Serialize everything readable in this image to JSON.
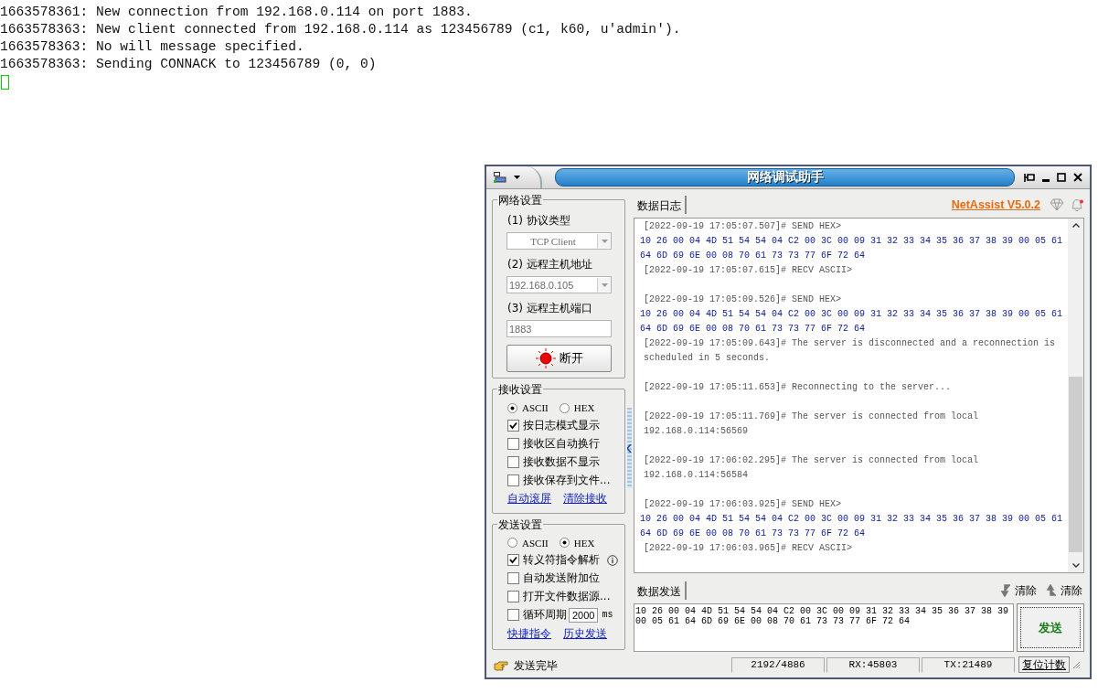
{
  "terminal": {
    "lines": [
      "1663578361: New connection from 192.168.0.114 on port 1883.",
      "1663578363: New client connected from 192.168.0.114 as 123456789 (c1, k60, u'admin').",
      "1663578363: No will message specified.",
      "1663578363: Sending CONNACK to 123456789 (0, 0)"
    ],
    "cursor_visible": true
  },
  "window": {
    "title": "网络调试助手",
    "product_link": "NetAssist V5.0.2"
  },
  "network_settings": {
    "title": "网络设置",
    "fields": [
      {
        "label": "(1) 协议类型",
        "kind": "select",
        "value": "TCP Client",
        "disabled": true
      },
      {
        "label": "(2) 远程主机地址",
        "kind": "select",
        "value": "192.168.0.105",
        "disabled": true
      },
      {
        "label": "(3) 远程主机端口",
        "kind": "input",
        "value": "1883",
        "disabled": true
      }
    ],
    "connect_button": {
      "label": "断开",
      "led_on": true
    }
  },
  "receive_settings": {
    "title": "接收设置",
    "radios": [
      {
        "label": "ASCII",
        "selected": true
      },
      {
        "label": "HEX",
        "selected": false
      }
    ],
    "options": [
      {
        "kind": "plain",
        "label": "按日志模式显示",
        "checked": true
      },
      {
        "kind": "plain",
        "label": "接收区自动换行",
        "checked": false
      },
      {
        "kind": "plain",
        "label": "接收数据不显示",
        "checked": false
      },
      {
        "kind": "plain",
        "label": "接收保存到文件...",
        "checked": false
      }
    ],
    "links": [
      "自动滚屏",
      "清除接收"
    ]
  },
  "send_settings": {
    "title": "发送设置",
    "radios": [
      {
        "label": "ASCII",
        "selected": false
      },
      {
        "label": "HEX",
        "selected": true
      }
    ],
    "options": [
      {
        "kind": "info",
        "label": "转义符指令解析",
        "checked": true
      },
      {
        "kind": "plain",
        "label": "自动发送附加位",
        "checked": false
      },
      {
        "kind": "plain",
        "label": "打开文件数据源...",
        "checked": false
      },
      {
        "kind": "period",
        "label": "循环周期",
        "checked": false,
        "value": "2000",
        "unit": "ms"
      }
    ],
    "links": [
      "快捷指令",
      "历史发送"
    ]
  },
  "status_message": "发送完毕",
  "log": {
    "tab": "数据日志",
    "blocks": [
      [
        {
          "kind": "info",
          "text": "[2022-09-19 17:05:07.507]# SEND HEX>"
        },
        {
          "kind": "hex",
          "text": "10 26 00 04 4D 51 54 54 04 C2 00 3C 00 09 31 32 33 34 35 36 37 38 39 00 05 61"
        },
        {
          "kind": "hex",
          "text": "64 6D 69 6E 00 08 70 61 73 73 77 6F 72 64"
        },
        {
          "kind": "info",
          "text": "[2022-09-19 17:05:07.615]# RECV ASCII>"
        }
      ],
      [
        {
          "kind": "info",
          "text": "[2022-09-19 17:05:09.526]# SEND HEX>"
        },
        {
          "kind": "hex",
          "text": "10 26 00 04 4D 51 54 54 04 C2 00 3C 00 09 31 32 33 34 35 36 37 38 39 00 05 61"
        },
        {
          "kind": "hex",
          "text": "64 6D 69 6E 00 08 70 61 73 73 77 6F 72 64"
        },
        {
          "kind": "info",
          "text": "[2022-09-19 17:05:09.643]# The server is disconnected and a reconnection is"
        },
        {
          "kind": "info",
          "text": "scheduled in 5 seconds."
        }
      ],
      [
        {
          "kind": "info",
          "text": "[2022-09-19 17:05:11.653]# Reconnecting to the server..."
        }
      ],
      [
        {
          "kind": "info",
          "text": "[2022-09-19 17:05:11.769]# The server is connected from local"
        },
        {
          "kind": "info",
          "text": "192.168.0.114:56569"
        }
      ],
      [
        {
          "kind": "info",
          "text": "[2022-09-19 17:06:02.295]# The server is connected from local"
        },
        {
          "kind": "info",
          "text": "192.168.0.114:56584"
        }
      ],
      [
        {
          "kind": "info",
          "text": "[2022-09-19 17:06:03.925]# SEND HEX>"
        },
        {
          "kind": "hex",
          "text": "10 26 00 04 4D 51 54 54 04 C2 00 3C 00 09 31 32 33 34 35 36 37 38 39 00 05 61"
        },
        {
          "kind": "hex",
          "text": "64 6D 69 6E 00 08 70 61 73 73 77 6F 72 64"
        },
        {
          "kind": "info",
          "text": "[2022-09-19 17:06:03.965]# RECV ASCII>"
        }
      ]
    ]
  },
  "send": {
    "tab": "数据发送",
    "clear_buttons": [
      {
        "kind": "down",
        "label": "清除"
      },
      {
        "kind": "up",
        "label": "清除"
      }
    ],
    "value_lines": [
      "10 26 00 04 4D 51 54 54 04 C2 00 3C 00 09 31 32 33 34 35 36 37 38 39",
      "00 05 61 64 6D 69 6E 00 08 70 61 73 73 77 6F 72 64"
    ],
    "send_button": "发送"
  },
  "status_bar": {
    "counter": "2192/4886",
    "rx": "RX:45803",
    "tx": "TX:21489",
    "reset_button": "复位计数"
  }
}
